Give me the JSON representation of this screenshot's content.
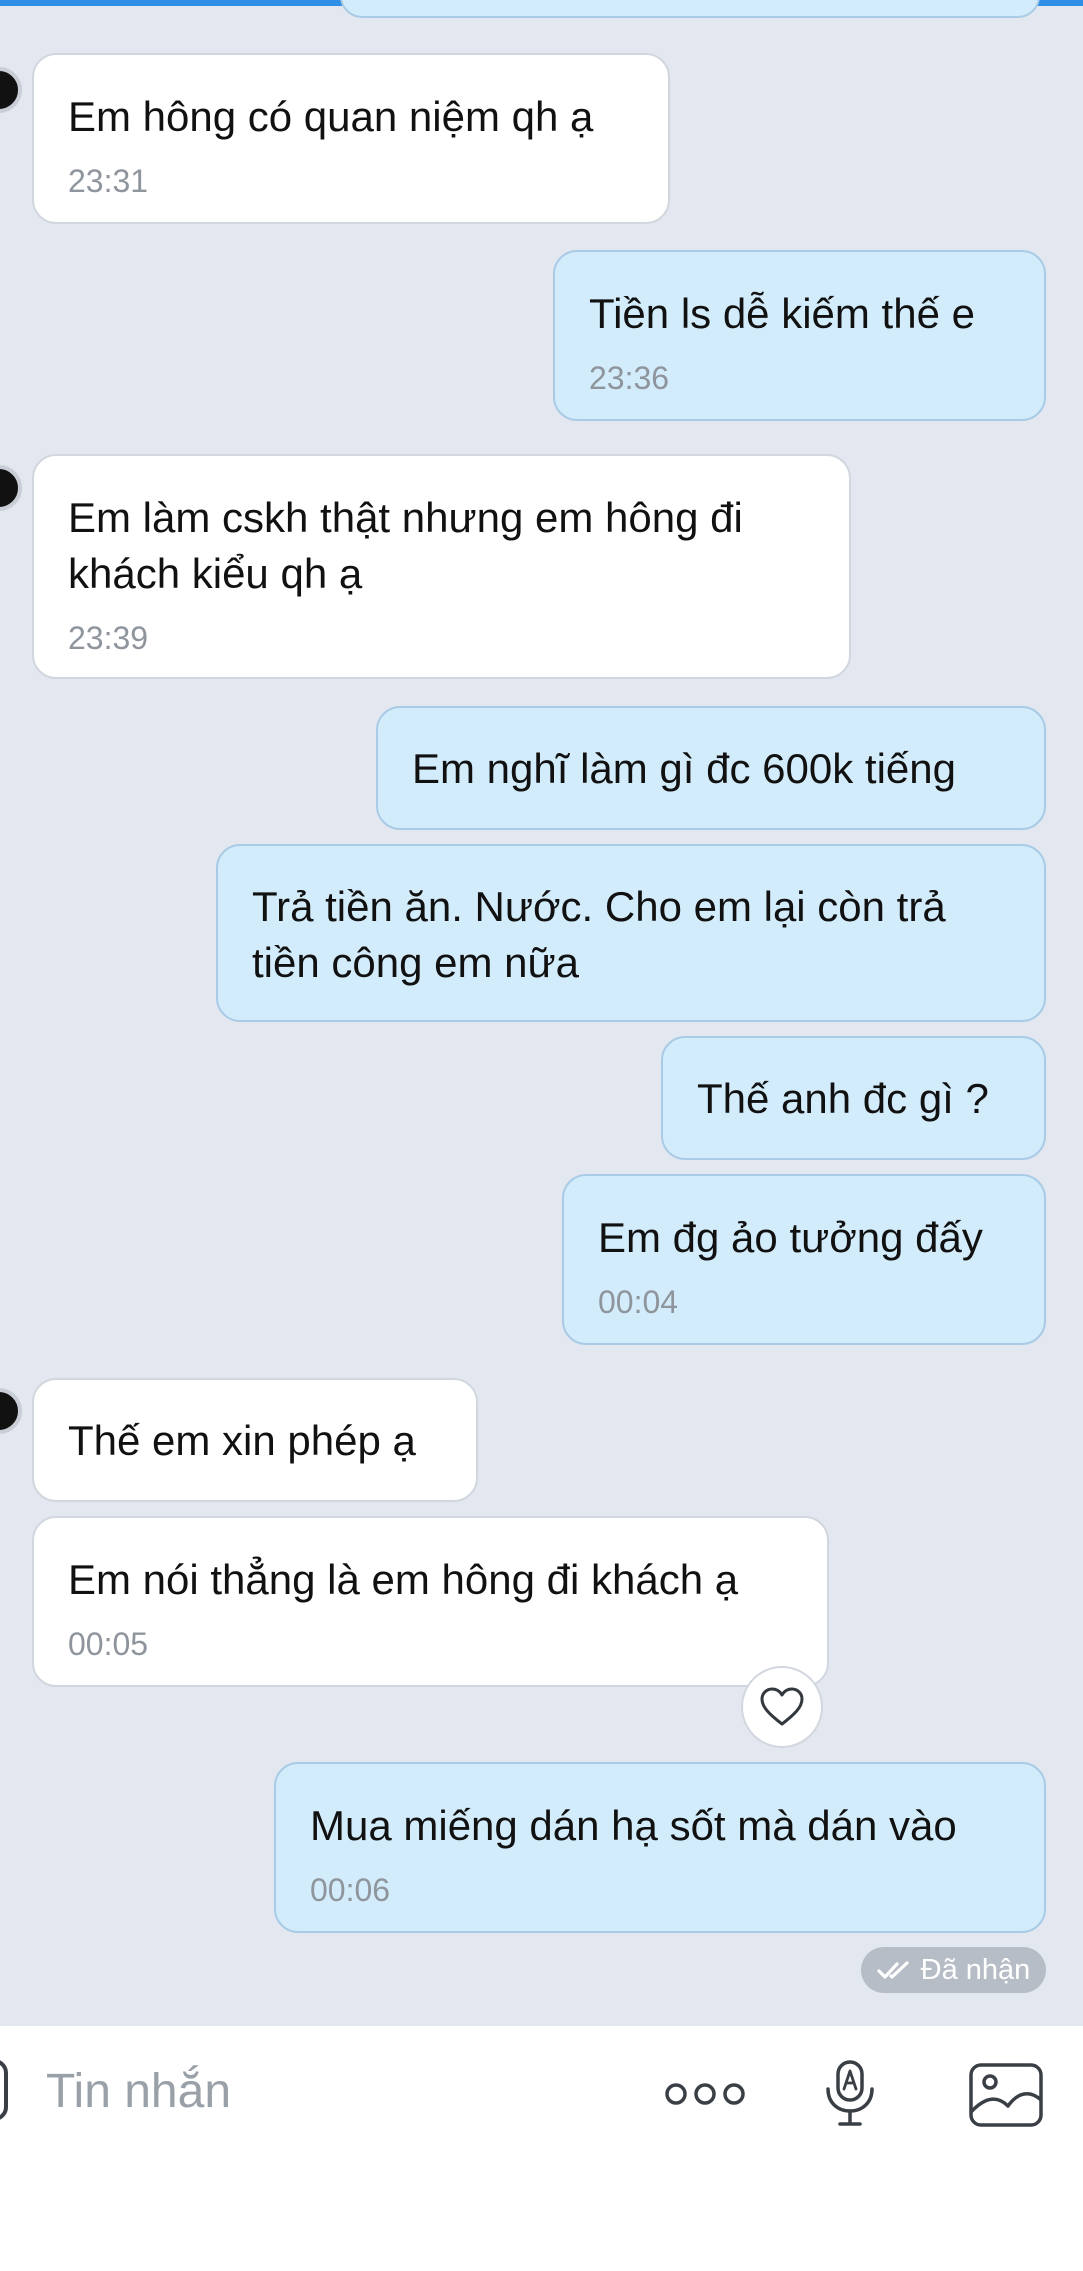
{
  "conversation": {
    "messages": [
      {
        "direction": "in",
        "text": "Em hông có quan niệm qh ạ",
        "time": "23:31"
      },
      {
        "direction": "out",
        "text": "Tiền ls dễ kiếm thế e",
        "time": "23:36"
      },
      {
        "direction": "in",
        "text": "Em làm cskh thật nhưng em hông đi khách kiểu qh ạ",
        "time": "23:39"
      },
      {
        "direction": "out",
        "text": "Em nghĩ làm gì đc 600k tiếng"
      },
      {
        "direction": "out",
        "text": "Trả tiền ăn. Nước. Cho em lại còn trả tiền công em nữa"
      },
      {
        "direction": "out",
        "text": "Thế anh đc gì ?"
      },
      {
        "direction": "out",
        "text": "Em đg ảo tưởng đấy",
        "time": "00:04"
      },
      {
        "direction": "in",
        "text": "Thế em xin phép ạ"
      },
      {
        "direction": "in",
        "text": "Em nói thẳng là em hông đi khách ạ",
        "time": "00:05"
      },
      {
        "direction": "out",
        "text": "Mua miếng dán hạ sốt mà dán vào",
        "time": "00:06"
      }
    ],
    "delivery_status": "Đã nhận",
    "reaction_icon": "heart-icon"
  },
  "composer": {
    "placeholder": "Tin nhắn",
    "icons": [
      "more-options-icon",
      "voice-to-text-icon",
      "image-gallery-icon"
    ]
  },
  "colors": {
    "chat_background": "#e3e8f0",
    "incoming_bubble": "#ffffff",
    "outgoing_bubble": "#d3ecfb",
    "outgoing_border": "#a9cbe6",
    "top_accent": "#2f8ee6",
    "timestamp": "#8f959d",
    "status_pill": "#b7bdc6"
  }
}
